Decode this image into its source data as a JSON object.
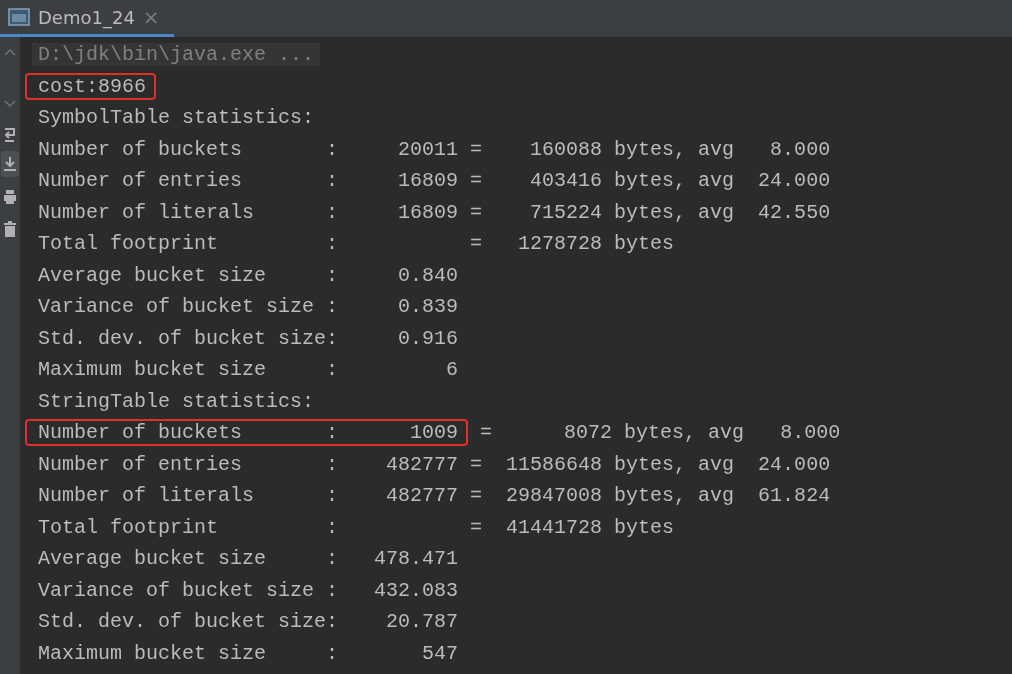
{
  "tab": {
    "title": "Demo1_24",
    "close": "×",
    "selected": true
  },
  "command": "D:\\jdk\\bin\\java.exe ...",
  "lines": [
    {
      "text": "cost:8966",
      "boxed": true
    },
    {
      "text": "SymbolTable statistics:",
      "boxed": false
    },
    {
      "text": "Number of buckets       :     20011 =    160088 bytes, avg   8.000",
      "boxed": false
    },
    {
      "text": "Number of entries       :     16809 =    403416 bytes, avg  24.000",
      "boxed": false
    },
    {
      "text": "Number of literals      :     16809 =    715224 bytes, avg  42.550",
      "boxed": false
    },
    {
      "text": "Total footprint         :           =   1278728 bytes",
      "boxed": false
    },
    {
      "text": "Average bucket size     :     0.840",
      "boxed": false
    },
    {
      "text": "Variance of bucket size :     0.839",
      "boxed": false
    },
    {
      "text": "Std. dev. of bucket size:     0.916",
      "boxed": false
    },
    {
      "text": "Maximum bucket size     :         6",
      "boxed": false
    },
    {
      "text": "StringTable statistics:",
      "boxed": false
    },
    {
      "text": "Number of buckets       :      1009",
      "boxed": true,
      "tail": " =      8072 bytes, avg   8.000"
    },
    {
      "text": "Number of entries       :    482777 =  11586648 bytes, avg  24.000",
      "boxed": false
    },
    {
      "text": "Number of literals      :    482777 =  29847008 bytes, avg  61.824",
      "boxed": false
    },
    {
      "text": "Total footprint         :           =  41441728 bytes",
      "boxed": false
    },
    {
      "text": "Average bucket size     :   478.471",
      "boxed": false
    },
    {
      "text": "Variance of bucket size :   432.083",
      "boxed": false
    },
    {
      "text": "Std. dev. of bucket size:    20.787",
      "boxed": false
    },
    {
      "text": "Maximum bucket size     :       547",
      "boxed": false
    }
  ]
}
